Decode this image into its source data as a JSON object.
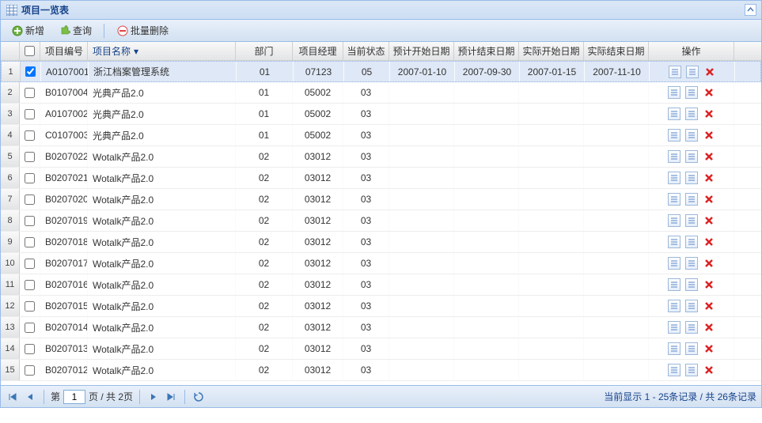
{
  "panel": {
    "title": "项目一览表"
  },
  "toolbar": {
    "add": "新增",
    "search": "查询",
    "batchDelete": "批量删除"
  },
  "columns": {
    "code": "项目编号",
    "name": "项目名称",
    "dept": "部门",
    "mgr": "项目经理",
    "status": "当前状态",
    "planStart": "预计开始日期",
    "planEnd": "预计结束日期",
    "actualStart": "实际开始日期",
    "actualEnd": "实际结束日期",
    "ops": "操作"
  },
  "rows": [
    {
      "n": "1",
      "checked": true,
      "code": "A0107001",
      "name": "浙江档案管理系统",
      "dept": "01",
      "mgr": "07123",
      "status": "05",
      "ps": "2007-01-10",
      "pe": "2007-09-30",
      "as": "2007-01-15",
      "ae": "2007-11-10"
    },
    {
      "n": "2",
      "checked": false,
      "code": "B0107004",
      "name": "光典产品2.0",
      "dept": "01",
      "mgr": "05002",
      "status": "03",
      "ps": "",
      "pe": "",
      "as": "",
      "ae": ""
    },
    {
      "n": "3",
      "checked": false,
      "code": "A0107002",
      "name": "光典产品2.0",
      "dept": "01",
      "mgr": "05002",
      "status": "03",
      "ps": "",
      "pe": "",
      "as": "",
      "ae": ""
    },
    {
      "n": "4",
      "checked": false,
      "code": "C0107003",
      "name": "光典产品2.0",
      "dept": "01",
      "mgr": "05002",
      "status": "03",
      "ps": "",
      "pe": "",
      "as": "",
      "ae": ""
    },
    {
      "n": "5",
      "checked": false,
      "code": "B0207022",
      "name": "Wotalk产品2.0",
      "dept": "02",
      "mgr": "03012",
      "status": "03",
      "ps": "",
      "pe": "",
      "as": "",
      "ae": ""
    },
    {
      "n": "6",
      "checked": false,
      "code": "B0207021",
      "name": "Wotalk产品2.0",
      "dept": "02",
      "mgr": "03012",
      "status": "03",
      "ps": "",
      "pe": "",
      "as": "",
      "ae": ""
    },
    {
      "n": "7",
      "checked": false,
      "code": "B0207020",
      "name": "Wotalk产品2.0",
      "dept": "02",
      "mgr": "03012",
      "status": "03",
      "ps": "",
      "pe": "",
      "as": "",
      "ae": ""
    },
    {
      "n": "8",
      "checked": false,
      "code": "B0207019",
      "name": "Wotalk产品2.0",
      "dept": "02",
      "mgr": "03012",
      "status": "03",
      "ps": "",
      "pe": "",
      "as": "",
      "ae": ""
    },
    {
      "n": "9",
      "checked": false,
      "code": "B0207018",
      "name": "Wotalk产品2.0",
      "dept": "02",
      "mgr": "03012",
      "status": "03",
      "ps": "",
      "pe": "",
      "as": "",
      "ae": ""
    },
    {
      "n": "10",
      "checked": false,
      "code": "B0207017",
      "name": "Wotalk产品2.0",
      "dept": "02",
      "mgr": "03012",
      "status": "03",
      "ps": "",
      "pe": "",
      "as": "",
      "ae": ""
    },
    {
      "n": "11",
      "checked": false,
      "code": "B0207016",
      "name": "Wotalk产品2.0",
      "dept": "02",
      "mgr": "03012",
      "status": "03",
      "ps": "",
      "pe": "",
      "as": "",
      "ae": ""
    },
    {
      "n": "12",
      "checked": false,
      "code": "B0207015",
      "name": "Wotalk产品2.0",
      "dept": "02",
      "mgr": "03012",
      "status": "03",
      "ps": "",
      "pe": "",
      "as": "",
      "ae": ""
    },
    {
      "n": "13",
      "checked": false,
      "code": "B0207014",
      "name": "Wotalk产品2.0",
      "dept": "02",
      "mgr": "03012",
      "status": "03",
      "ps": "",
      "pe": "",
      "as": "",
      "ae": ""
    },
    {
      "n": "14",
      "checked": false,
      "code": "B0207013",
      "name": "Wotalk产品2.0",
      "dept": "02",
      "mgr": "03012",
      "status": "03",
      "ps": "",
      "pe": "",
      "as": "",
      "ae": ""
    },
    {
      "n": "15",
      "checked": false,
      "code": "B0207012",
      "name": "Wotalk产品2.0",
      "dept": "02",
      "mgr": "03012",
      "status": "03",
      "ps": "",
      "pe": "",
      "as": "",
      "ae": ""
    }
  ],
  "paging": {
    "pageLabelPrefix": "第",
    "pageValue": "1",
    "pageLabelSuffix": "页 / 共 2页",
    "status": "当前显示 1 - 25条记录 / 共 26条记录"
  }
}
